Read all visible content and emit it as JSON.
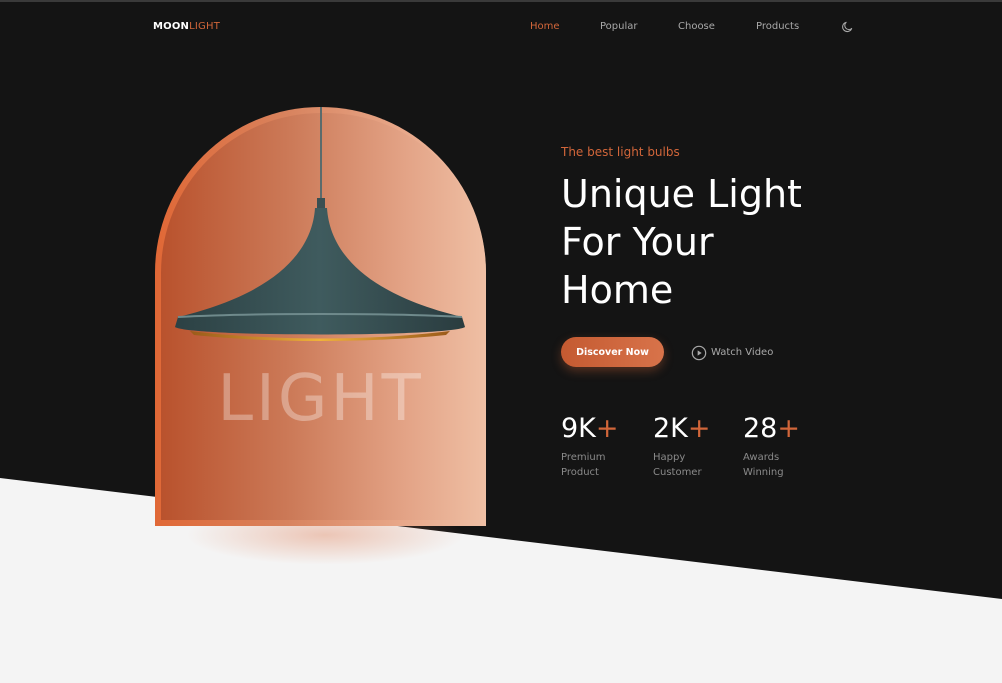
{
  "brand": {
    "part1": "MOON",
    "part2": "LIGHT"
  },
  "nav": {
    "items": [
      "Home",
      "Popular",
      "Choose",
      "Products"
    ],
    "active": "Home",
    "theme_icon": "moon-icon"
  },
  "hero": {
    "image_word": "LIGHT",
    "subtitle": "The best light bulbs",
    "headline": [
      "Unique Light",
      "For Your",
      "Home"
    ],
    "primary_button": "Discover Now",
    "secondary_button": "Watch Video",
    "secondary_icon": "play-circle-icon"
  },
  "stats": [
    {
      "value": "9K",
      "suffix": "+",
      "line1": "Premium",
      "line2": "Product"
    },
    {
      "value": "2K",
      "suffix": "+",
      "line1": "Happy",
      "line2": "Customer"
    },
    {
      "value": "28",
      "suffix": "+",
      "line1": "Awards",
      "line2": "Winning"
    }
  ],
  "colors": {
    "accent": "#d2663a",
    "dark_bg": "#141414",
    "light_bg": "#f4f4f4",
    "text": "#ffffff",
    "muted": "#a9a9a9"
  }
}
